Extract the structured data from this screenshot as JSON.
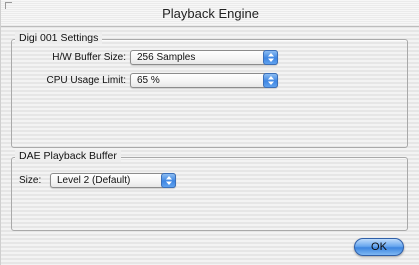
{
  "window": {
    "title": "Playback Engine"
  },
  "digi_group": {
    "title": "Digi 001 Settings",
    "buffer": {
      "label": "H/W Buffer Size:",
      "value": "256 Samples"
    },
    "cpu": {
      "label": "CPU Usage Limit:",
      "value": "65 %"
    }
  },
  "dae_group": {
    "title": "DAE Playback Buffer",
    "size": {
      "label": "Size:",
      "value": "Level 2 (Default)"
    }
  },
  "buttons": {
    "ok": "OK"
  },
  "icons": {
    "popup_arrows": "up-down-arrows-icon"
  },
  "colors": {
    "accent": "#3e86e3",
    "group_border": "#a9a9a9"
  }
}
